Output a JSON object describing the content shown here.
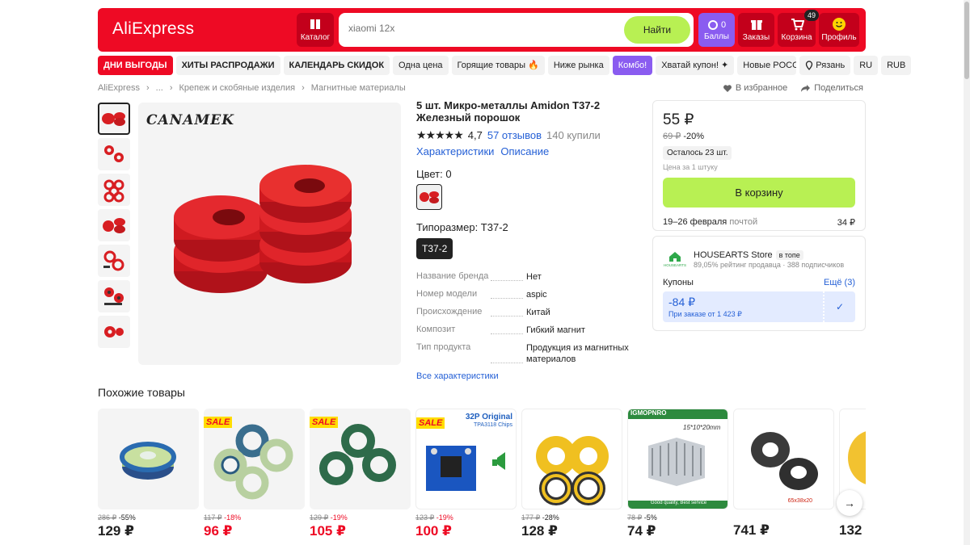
{
  "header": {
    "logo": "AliExpress",
    "catalog_label": "Каталог",
    "search_placeholder": "xiaomi 12x",
    "search_button": "Найти",
    "points_count": "0",
    "points_label": "Баллы",
    "orders_label": "Заказы",
    "cart_label": "Корзина",
    "cart_count": "49",
    "profile_label": "Профиль"
  },
  "promo": [
    {
      "label": "ДНИ ВЫГОДЫ",
      "style": "red"
    },
    {
      "label": "ХИТЫ РАСПРОДАЖИ",
      "style": "bold"
    },
    {
      "label": "КАЛЕНДАРЬ СКИДОК",
      "style": "bold"
    },
    {
      "label": "Одна цена",
      "style": "plain"
    },
    {
      "label": "Горящие товары 🔥",
      "style": "plain"
    },
    {
      "label": "Ниже рынка",
      "style": "plain"
    },
    {
      "label": "Комбо!",
      "style": "violet"
    },
    {
      "label": "Хватай купон! ✦",
      "style": "plain"
    },
    {
      "label": "Новые POCO M",
      "style": "plain"
    },
    {
      "label": "Рязань",
      "style": "plain"
    },
    {
      "label": "RU",
      "style": "plain"
    },
    {
      "label": "RUB",
      "style": "plain"
    }
  ],
  "breadcrumb": [
    "AliExpress",
    "›",
    "...",
    "›",
    "Крепеж и скобяные изделия",
    "›",
    "Магнитные материалы"
  ],
  "actions": {
    "favorite": "В избранное",
    "share": "Поделиться"
  },
  "gallery": {
    "brand": "CANAMEK",
    "thumb_count": 7
  },
  "product": {
    "title": "5 шт. Микро-металлы Amidon T37-2 Железный порошок",
    "rating": "4,7",
    "reviews": "57 отзывов",
    "bought": "140 купили",
    "tab_characteristics": "Характеристики",
    "tab_description": "Описание",
    "color_label": "Цвет: 0",
    "size_label": "Типоразмер: T37-2",
    "size_value": "T37-2",
    "specs": [
      {
        "k": "Название бренда",
        "v": "Нет"
      },
      {
        "k": "Номер модели",
        "v": "aspic"
      },
      {
        "k": "Происхождение",
        "v": "Китай"
      },
      {
        "k": "Композит",
        "v": "Гибкий магнит"
      },
      {
        "k": "Тип продукта",
        "v": "Продукция из магнитных материалов"
      }
    ],
    "all_specs": "Все характеристики"
  },
  "buy": {
    "price": "55 ₽",
    "old_price": "69 ₽",
    "discount": "-20%",
    "stock": "Осталось 23 шт.",
    "per_unit": "Цена за 1 штуку",
    "cart_button": "В корзину",
    "delivery_dates": "19–26 февраля",
    "delivery_mode": "почтой",
    "delivery_cost": "34 ₽"
  },
  "store": {
    "name": "HOUSEARTS Store",
    "badge": "в топе",
    "meta": "89,05% рейтинг продавца · 388 подписчиков",
    "logo_text": "HOUSEARTS",
    "coupons_label": "Купоны",
    "coupons_more": "Ещё (3)",
    "coupon_amount": "-84 ₽",
    "coupon_condition": "При заказе от 1 423 ₽"
  },
  "similar": {
    "title": "Похожие товары",
    "items": [
      {
        "old": "286 ₽",
        "disc": "-55%",
        "price": "129 ₽",
        "sale": false,
        "red": false
      },
      {
        "old": "117 ₽",
        "disc": "-18%",
        "price": "96 ₽",
        "sale": true,
        "red": true
      },
      {
        "old": "129 ₽",
        "disc": "-19%",
        "price": "105 ₽",
        "sale": true,
        "red": true
      },
      {
        "old": "123 ₽",
        "disc": "-19%",
        "price": "100 ₽",
        "sale": true,
        "red": true,
        "banner": "32P Original",
        "banner2": "TPA3118 Chips"
      },
      {
        "old": "177 ₽",
        "disc": "-28%",
        "price": "128 ₽",
        "sale": false,
        "red": false
      },
      {
        "old": "78 ₽",
        "disc": "-5%",
        "price": "74 ₽",
        "sale": false,
        "red": false,
        "banner": "IGMOPNRO",
        "banner2": "15*10*20mm",
        "footer": "Good quality, Best service"
      },
      {
        "old": "",
        "disc": "",
        "price": "741 ₽",
        "sale": false,
        "red": false,
        "note": "65x38x20"
      },
      {
        "old": "",
        "disc": "",
        "price": "132",
        "sale": false,
        "red": false
      }
    ],
    "sale_label": "SALE"
  },
  "colors": {
    "brand_red": "#ee0a24",
    "accent_green": "#b8f053",
    "violet": "#8a5cf0",
    "link": "#2560d6"
  }
}
